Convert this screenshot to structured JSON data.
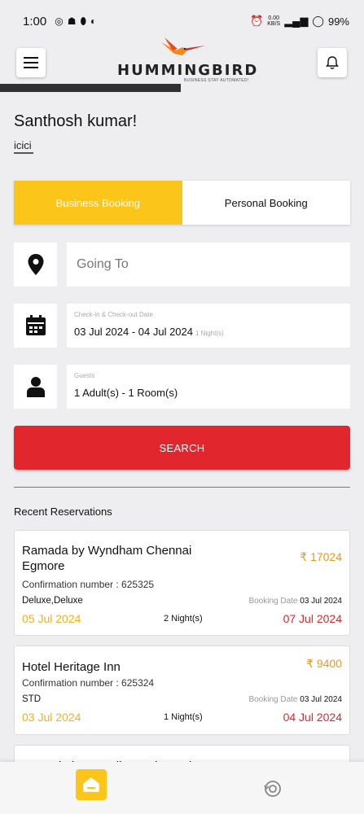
{
  "status_bar": {
    "time": "1:00",
    "data_speed": "0.00",
    "data_unit": "KB/S",
    "battery": "99%"
  },
  "header": {
    "logo_text": "HUMMINGBIRD",
    "logo_tagline": "BUSINESS STAY AUTOMATED!"
  },
  "user": {
    "greeting": "Santhosh kumar!",
    "company": "icici"
  },
  "booking_toggle": {
    "business_label": "Business Booking",
    "personal_label": "Personal Booking"
  },
  "form": {
    "destination_placeholder": "Going To",
    "dates_label": "Check-in & Check-out Date",
    "dates_value": "03 Jul 2024 - 04 Jul 2024",
    "nights_label": "1 Night(s)",
    "guests_label": "Guests",
    "guests_value": "1 Adult(s) - 1 Room(s)",
    "search_label": "SEARCH"
  },
  "recent": {
    "title": "Recent Reservations",
    "reservations": [
      {
        "hotel": "Ramada by Wyndham Chennai Egmore",
        "price": "₹ 17024",
        "confirmation": "Confirmation number : 625325",
        "room": "Deluxe,Deluxe",
        "booking_date_label": "Booking Date",
        "booking_date": "03 Jul 2024",
        "check_in": "05 Jul 2024",
        "nights": "2 Night(s)",
        "check_out": "07 Jul 2024"
      },
      {
        "hotel": "Hotel Heritage Inn",
        "price": "₹ 9400",
        "confirmation": "Confirmation number : 625324",
        "room": "STD",
        "booking_date_label": "Booking Date",
        "booking_date": "03 Jul 2024",
        "check_in": "03 Jul 2024",
        "nights": "1 Night(s)",
        "check_out": "04 Jul 2024"
      },
      {
        "hotel": "Ramada by Wyndham Chennai"
      }
    ]
  },
  "colors": {
    "accent_yellow": "#fcc51a",
    "search_red": "#e1262e",
    "price_orange": "#e69a1f",
    "checkout_red": "#d9292f"
  },
  "icons": {
    "menu": "hamburger-icon",
    "bell": "bell-icon",
    "location": "location-pin-icon",
    "calendar": "calendar-icon",
    "guest": "person-icon",
    "home": "home-icon",
    "history": "history-icon"
  }
}
